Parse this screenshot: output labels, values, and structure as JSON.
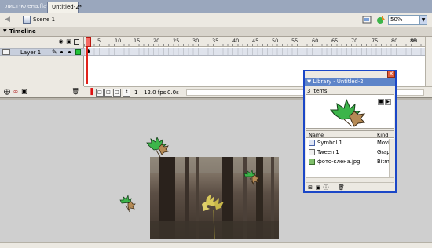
{
  "tabs": [
    {
      "label": "лист-клена.fla*",
      "active": false
    },
    {
      "label": "Untitled-2*",
      "active": true
    }
  ],
  "scene": {
    "label": "Scene 1"
  },
  "zoom": {
    "value": "50%"
  },
  "timeline": {
    "label": "Timeline",
    "ruler": [
      "5",
      "10",
      "15",
      "20",
      "25",
      "30",
      "35",
      "40",
      "45",
      "50",
      "55",
      "60",
      "65",
      "70",
      "75",
      "80",
      "85",
      "90"
    ],
    "layer_name": "Layer 1",
    "current_frame": "1",
    "fps": "12.0 fps",
    "time": "0.0s"
  },
  "library": {
    "title": "Library - Untitled-2",
    "count": "3 items",
    "columns": {
      "name": "Name",
      "kind": "Kind"
    },
    "items": [
      {
        "name": "Symbol 1",
        "kind": "Movi"
      },
      {
        "name": "Tween 1",
        "kind": "Grap"
      },
      {
        "name": "фото-клена.jpg",
        "kind": "Bitm"
      }
    ]
  },
  "colors": {
    "title_bar": "#5d84c9",
    "layer_highlight": "#c8cfdd",
    "leaf_green": "#3cb54a",
    "leaf_brown": "#b58a55",
    "playhead": "#e1231c"
  }
}
